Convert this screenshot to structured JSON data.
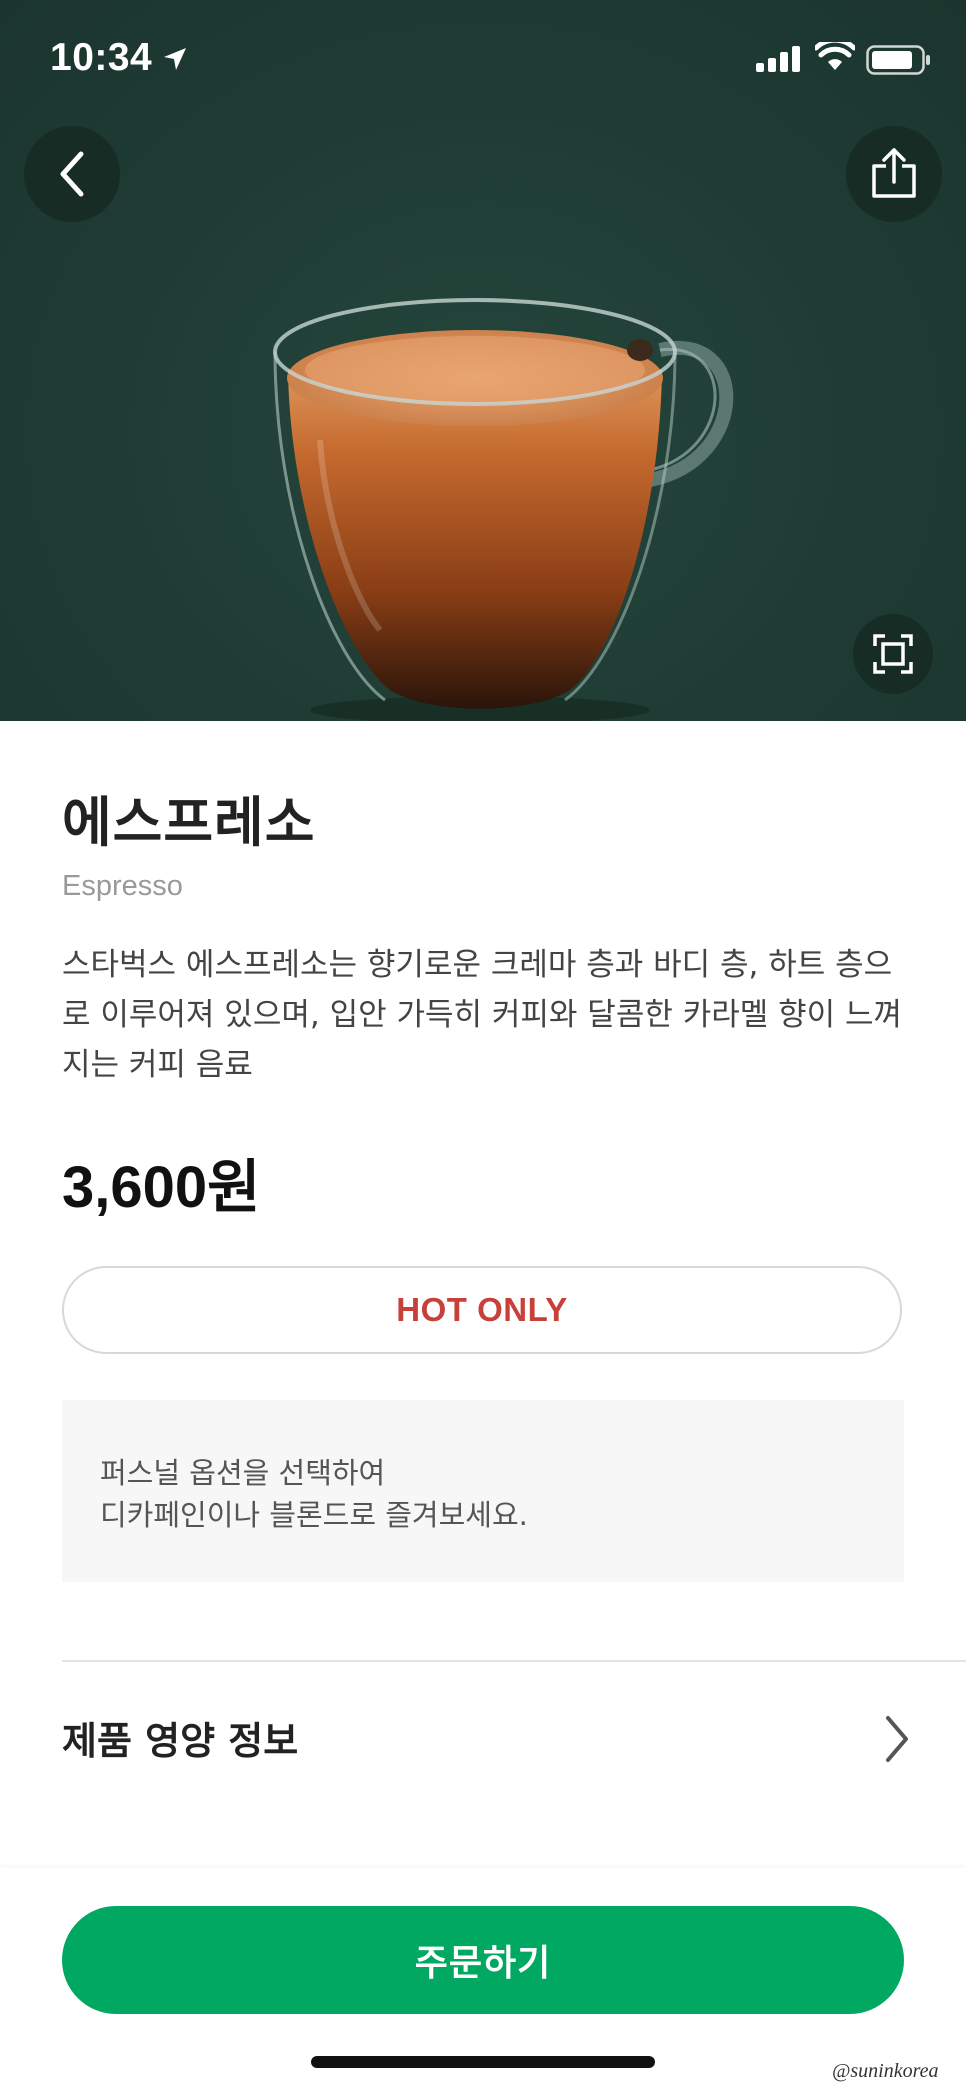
{
  "status_bar": {
    "time": "10:34"
  },
  "product": {
    "name_ko": "에스프레소",
    "name_en": "Espresso",
    "description": "스타벅스 에스프레소는 향기로운 크레마 층과 바디 층, 하트 층으로 이루어져 있으며, 입안 가득히 커피와 달콤한 카라멜 향이 느껴지는 커피 음료",
    "price": "3,600원",
    "temperature_option": "HOT ONLY"
  },
  "notice": {
    "line1": "퍼스널 옵션을 선택하여",
    "line2": "디카페인이나 블론드로 즐겨보세요."
  },
  "nutrition": {
    "label": "제품 영양 정보"
  },
  "order": {
    "button_label": "주문하기"
  },
  "watermark": "@suninkorea",
  "icons": {
    "back": "chevron-left-icon",
    "share": "share-icon",
    "expand": "expand-icon",
    "nutrition_chevron": "chevron-right-icon"
  },
  "colors": {
    "hero_bg": "#1f3d35",
    "order_button": "#00a862",
    "hot_only": "#c8403a"
  }
}
